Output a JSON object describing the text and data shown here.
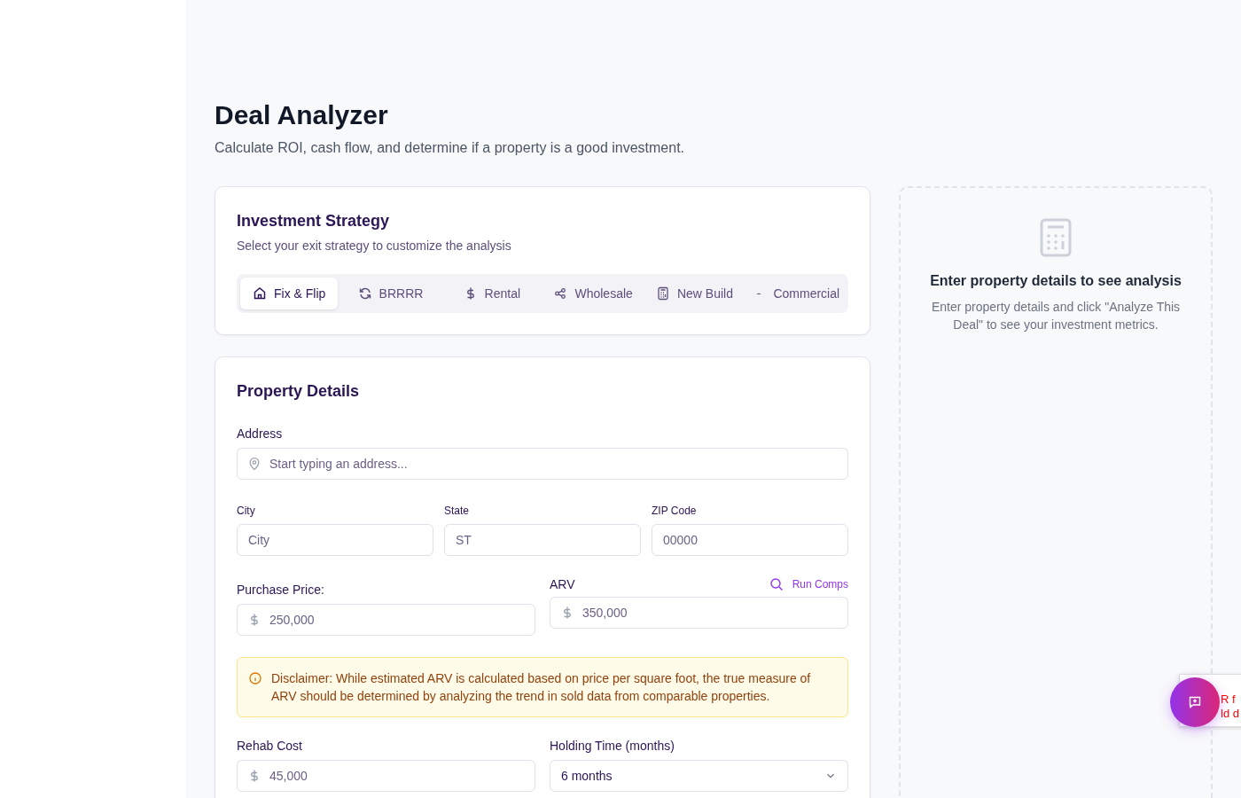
{
  "page": {
    "title": "Deal Analyzer",
    "subtitle": "Calculate ROI, cash flow, and determine if a property is a good investment."
  },
  "strategy": {
    "title": "Investment Strategy",
    "subtitle": "Select your exit strategy to customize the analysis",
    "tabs": [
      {
        "label": "Fix & Flip",
        "selected": true
      },
      {
        "label": "BRRRR",
        "selected": false
      },
      {
        "label": "Rental",
        "selected": false
      },
      {
        "label": "Wholesale",
        "selected": false
      },
      {
        "label": "New Build",
        "selected": false
      },
      {
        "label": "Commercial",
        "selected": false
      }
    ]
  },
  "property": {
    "title": "Property Details",
    "address": {
      "label": "Address",
      "placeholder": "Start typing an address..."
    },
    "city": {
      "label": "City",
      "placeholder": "City"
    },
    "state": {
      "label": "State",
      "placeholder": "ST"
    },
    "zip": {
      "label": "ZIP Code",
      "placeholder": "00000"
    },
    "purchase_price": {
      "label": "Purchase Price:",
      "placeholder": "250,000"
    },
    "arv": {
      "label": "ARV",
      "placeholder": "350,000",
      "action": "Run Comps"
    },
    "disclaimer": "Disclaimer: While estimated ARV is calculated based on price per square foot, the true measure of ARV should be determined by analyzing the trend in sold data from comparable properties.",
    "rehab_cost": {
      "label": "Rehab Cost",
      "placeholder": "45,000"
    },
    "holding_time": {
      "label": "Holding Time (months)",
      "value": "6 months"
    }
  },
  "analysis": {
    "title": "Enter property details to see analysis",
    "text": "Enter property details and click \"Analyze This Deal\" to see your investment metrics."
  },
  "popup": {
    "lines": [
      "R f",
      "ld d"
    ]
  }
}
